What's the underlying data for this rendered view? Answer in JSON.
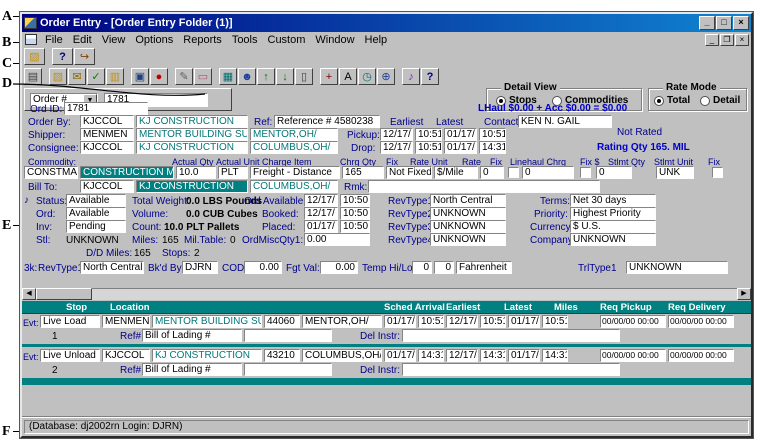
{
  "colors": {
    "titlebar_blue": "#000080",
    "titlebar_light": "#1084d0",
    "teal_header": "#008080",
    "label_blue": "#00008c",
    "value_blue": "#0000cc",
    "window_gray": "#c0c0c0"
  },
  "annotations": {
    "labels": [
      "A",
      "B",
      "C",
      "D",
      "E",
      "F"
    ]
  },
  "window": {
    "title": "Order Entry - [Order Entry Folder (1)]",
    "titlebar_buttons": {
      "minimize": "_",
      "maximize": "□",
      "close": "×"
    },
    "mdi_buttons": {
      "minimize": "_",
      "restore": "❐",
      "close": "×"
    }
  },
  "menu": {
    "items": [
      "File",
      "Edit",
      "View",
      "Options",
      "Reports",
      "Tools",
      "Custom",
      "Window",
      "Help"
    ]
  },
  "toolbar_small": {
    "buttons": [
      {
        "name": "open-folder-icon",
        "glyph": "▨"
      },
      {
        "name": "help-icon",
        "glyph": "?"
      },
      {
        "name": "exit-icon",
        "glyph": "↪"
      }
    ]
  },
  "toolbar_main": {
    "buttons": [
      {
        "name": "print-icon",
        "glyph": "▤"
      },
      {
        "name": "open-icon",
        "glyph": "▨"
      },
      {
        "name": "mail-icon",
        "glyph": "✉"
      },
      {
        "name": "folder-check-icon",
        "glyph": "✓"
      },
      {
        "name": "folder-add-icon",
        "glyph": "▥"
      },
      {
        "name": "monitor-icon",
        "glyph": "▣"
      },
      {
        "name": "record-icon",
        "glyph": "●"
      },
      {
        "name": "notepad-icon",
        "glyph": "✎"
      },
      {
        "name": "eraser-icon",
        "glyph": "▭"
      },
      {
        "name": "clipboard-icon",
        "glyph": "▦"
      },
      {
        "name": "people-icon",
        "glyph": "☻"
      },
      {
        "name": "arrow-up-icon",
        "glyph": "↑"
      },
      {
        "name": "arrow-down-icon",
        "glyph": "↓"
      },
      {
        "name": "page-icon",
        "glyph": "▯"
      },
      {
        "name": "anchor-icon",
        "glyph": "+"
      },
      {
        "name": "letter-a-icon",
        "glyph": "A"
      },
      {
        "name": "clock-icon",
        "glyph": "◷"
      },
      {
        "name": "globe-icon",
        "glyph": "⊕"
      },
      {
        "name": "music-note-icon",
        "glyph": "♪"
      },
      {
        "name": "toolbar-help-icon",
        "glyph": "?"
      }
    ]
  },
  "order_lookup": {
    "type_label": "Order #",
    "value": "1781"
  },
  "view_options": {
    "detail_view": {
      "label": "Detail View",
      "opt_stops": "Stops",
      "opt_commodities": "Commodities"
    },
    "rate_mode": {
      "label": "Rate Mode",
      "opt_total": "Total",
      "opt_detail": "Detail"
    }
  },
  "form": {
    "ord_id_label": "Ord ID:",
    "ord_id": "1781",
    "lhaul_summary": "LHaul $0.00 + Acc $0.00 = $0.00",
    "order_by_label": "Order By:",
    "order_by_code": "KJCCOL",
    "order_by_name": "KJ CONSTRUCTION",
    "ref_label": "Ref:",
    "ref_value": "Reference # 4580238",
    "earliest_label": "Earliest",
    "latest_label": "Latest",
    "contact_label": "Contact:",
    "contact_value": "KEN N. GAIL",
    "shipper_label": "Shipper:",
    "shipper_code": "MENMEN",
    "shipper_name": "MENTOR BUILDING SUF",
    "shipper_city": "MENTOR,OH/",
    "pickup_label": "Pickup:",
    "pickup_early_date": "12/17/",
    "pickup_early_time": "10:51",
    "pickup_late_date": "01/17/",
    "pickup_late_time": "10:51",
    "not_rated": "Not Rated",
    "consignee_label": "Consignee:",
    "consignee_code": "KJCCOL",
    "consignee_name": "KJ CONSTRUCTION",
    "consignee_city": "COLUMBUS,OH/",
    "drop_label": "Drop:",
    "drop_early_date": "12/17/",
    "drop_early_time": "10:51",
    "drop_late_date": "01/17/",
    "drop_late_time": "14:31",
    "rating_qty": "Rating Qty  165. MIL",
    "commodity": {
      "headers": [
        "Commodity:",
        "Actual Qty",
        "Actual Unit",
        "Charge Item",
        "Chrg Qty",
        "Fix",
        "Rate Unit",
        "Rate",
        "Fix",
        "Linehaul Chrg",
        "Fix $",
        "Stlmt Qty",
        "Stlmt Unit",
        "Fix"
      ],
      "code": "CONSTMA",
      "name": "CONSTRUCTION MA",
      "actual_qty": "10.0",
      "actual_unit": "PLT",
      "charge_item": "Freight - Distance",
      "chrg_qty": "165",
      "fix_value": "Not Fixed",
      "rate_unit": "$/Mile",
      "rate": "0",
      "linehaul_chrg": "0",
      "stlmt_qty": "0",
      "stlmt_unit": "UNK"
    },
    "bill_to": {
      "label": "Bill To:",
      "code": "KJCCOL",
      "name": "KJ CONSTRUCTION",
      "city": "COLUMBUS,OH/",
      "rmk_label": "Rmk:",
      "rmk_value": ""
    },
    "status": {
      "status_label": "Status:",
      "status_value": "Available",
      "total_weight_label": "Total Weight:",
      "total_weight_value": "0.0 LBS Pounds",
      "ord_label": "Ord:",
      "ord_value": "Available",
      "volume_label": "Volume:",
      "volume_value": "0.0 CUB Cubes",
      "inv_label": "Inv:",
      "inv_value": "Pending",
      "count_label": "Count:",
      "count_value": "10.0 PLT Pallets",
      "stl_label": "Stl:",
      "stl_value": "UNKNOWN",
      "miles_label": "Miles:",
      "miles_value": "165",
      "mil_table_label": "Mil.Table:",
      "mil_table_value": "0",
      "dd_miles_label": "D/D Miles:",
      "dd_miles_value": "165",
      "stops_label": "Stops:",
      "stops_value": "2",
      "ord_available_label": "Ord Available:",
      "ord_available_date": "12/17/",
      "ord_available_time": "10:50",
      "booked_label": "Booked:",
      "booked_date": "12/17/",
      "booked_time": "10:50",
      "placed_label": "Placed:",
      "placed_date": "01/17/",
      "placed_time": "10:50",
      "ord_misc_label": "OrdMiscQty1:",
      "ord_misc_value": "0.00",
      "revtype1_label": "RevType1",
      "revtype1_value": "North Central",
      "revtype2_label": "RevType2",
      "revtype2_value": "UNKNOWN",
      "revtype3_label": "RevType3",
      "revtype3_value": "UNKNOWN",
      "revtype4_label": "RevType4",
      "revtype4_value": "UNKNOWN",
      "terms_label": "Terms:",
      "terms_value": "Net 30 days",
      "priority_label": "Priority:",
      "priority_value": "Highest Priority",
      "currency_label": "Currency:",
      "currency_value": "$ U.S.",
      "company_label": "Company:",
      "company_value": "UNKNOWN"
    },
    "booking": {
      "prefix": "3k:",
      "revtype1_label": "RevType1",
      "revtype1_value": "North Central",
      "bkd_by_label": "Bk'd By:",
      "bkd_by_value": "DJRN",
      "cod_label": "COD:",
      "cod_value": "0.00",
      "fgt_val_label": "Fgt Val:",
      "fgt_val_value": "0.00",
      "temp_label": "Temp Hi/Lo:",
      "temp_hi": "0",
      "temp_lo": "0",
      "temp_unit": "Fahrenheit",
      "trltype1_label": "TrlType1",
      "trltype1_value": "UNKNOWN"
    }
  },
  "stops": {
    "headers": [
      "Stop",
      "Location",
      "Sched Arrival",
      "Earliest",
      "Latest",
      "Miles",
      "Req Pickup",
      "Req Delivery"
    ],
    "evt_label": "Evt:",
    "ref_label": "Ref#",
    "del_label": "Del Instr:",
    "rows": [
      {
        "stop_no": "1",
        "event": "Live Load",
        "code": "MENMEN",
        "name": "MENTOR BUILDING SU",
        "zip": "44060",
        "city": "MENTOR,OH/",
        "sched_date": "01/17/",
        "sched_time": "10:51",
        "early_date": "12/17/",
        "early_time": "10:51",
        "late_date": "01/17/",
        "late_time": "10:51",
        "miles": "",
        "req_pickup": "00/00/00 00:00",
        "req_delivery": "00/00/00 00:00",
        "ref_value": "Bill of Lading #",
        "ref2_value": "",
        "del_value": ""
      },
      {
        "stop_no": "2",
        "event": "Live Unload",
        "code": "KJCCOL",
        "name": "KJ CONSTRUCTION",
        "zip": "43210",
        "city": "COLUMBUS,OH/",
        "sched_date": "01/17/",
        "sched_time": "14:31",
        "early_date": "12/17/",
        "early_time": "14:31",
        "late_date": "01/17/",
        "late_time": "14:31",
        "miles": "",
        "req_pickup": "00/00/00 00:00",
        "req_delivery": "00/00/00 00:00",
        "ref_value": "Bill of Lading #",
        "ref2_value": "",
        "del_value": ""
      }
    ]
  },
  "statusbar": {
    "text": "(Database: dj2002rn   Login: DJRN)"
  }
}
